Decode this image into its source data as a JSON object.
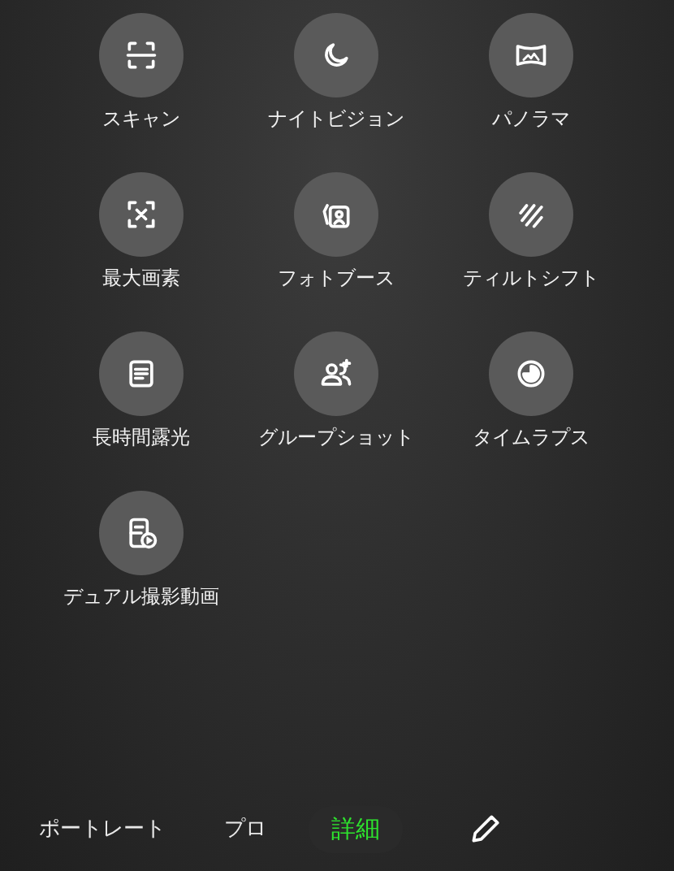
{
  "modes": [
    {
      "label": "スキャン",
      "kind": "scan"
    },
    {
      "label": "ナイトビジョン",
      "kind": "night"
    },
    {
      "label": "パノラマ",
      "kind": "panorama"
    },
    {
      "label": "最大画素",
      "kind": "max-pixels"
    },
    {
      "label": "フォトブース",
      "kind": "photo-booth"
    },
    {
      "label": "ティルトシフト",
      "kind": "tilt-shift"
    },
    {
      "label": "長時間露光",
      "kind": "long-exposure"
    },
    {
      "label": "グループショット",
      "kind": "group"
    },
    {
      "label": "タイムラプス",
      "kind": "timelapse"
    },
    {
      "label": "デュアル撮影動画",
      "kind": "dual-video"
    }
  ],
  "tabs": [
    {
      "label": "ポートレート",
      "selected": false
    },
    {
      "label": "プロ",
      "selected": false
    },
    {
      "label": "詳細",
      "selected": true
    }
  ]
}
